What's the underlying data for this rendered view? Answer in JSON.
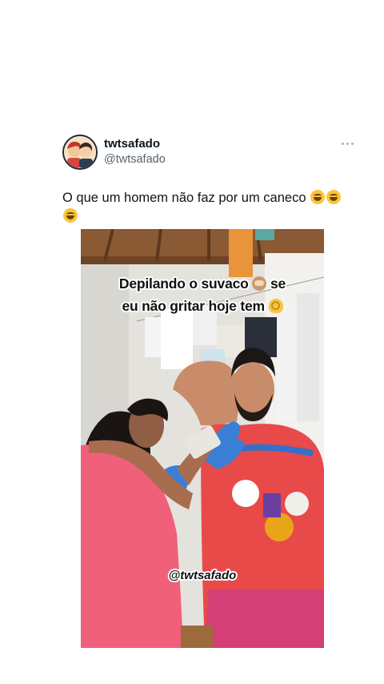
{
  "tweet": {
    "display_name": "twtsafado",
    "handle": "@twtsafado",
    "avatar_icon": "avatar-illustration",
    "more_icon": "more-options-icon",
    "text": "O que um homem não faz por um caneco",
    "text_emoji": [
      "face-with-tears-of-joy",
      "face-with-tears-of-joy",
      "face-with-tears-of-joy"
    ]
  },
  "media": {
    "caption_line1": "Depilando o suvaco",
    "caption_line1_suffix": "se",
    "caption_line2": "eu não gritar hoje tem",
    "caption_emoji": [
      "see-no-evil-monkey",
      "ok-hand"
    ],
    "watermark": "@twtsafado"
  },
  "colors": {
    "text_primary": "#0f1419",
    "text_secondary": "#536471",
    "shirt": "#e84a4a",
    "dress": "#f0607a",
    "glove": "#3a7fd5"
  }
}
